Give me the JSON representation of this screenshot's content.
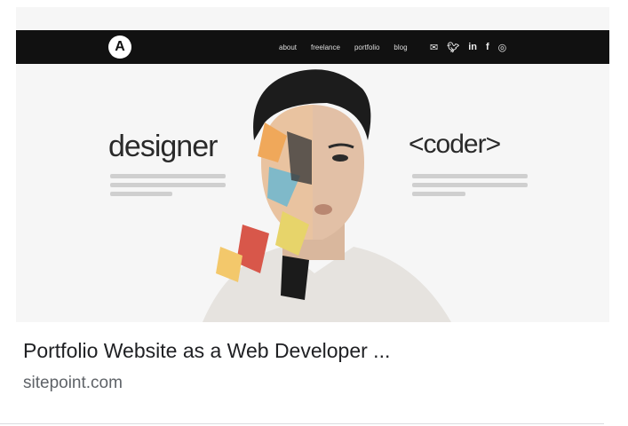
{
  "thumbnail": {
    "site_nav_links": [
      "about",
      "freelance",
      "portfolio",
      "blog"
    ],
    "social_icons": [
      "mail-icon",
      "twitter-icon",
      "linkedin-icon",
      "facebook-icon",
      "dribbble-icon"
    ],
    "headline_left": "designer",
    "headline_right": "<coder>"
  },
  "result": {
    "title": "Portfolio Website as a Web Developer ...",
    "source": "sitepoint.com"
  }
}
